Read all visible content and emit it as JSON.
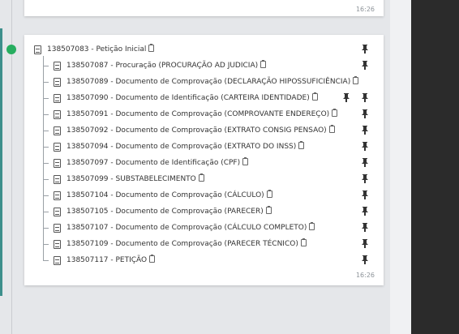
{
  "previous_card": {
    "time": "16:26"
  },
  "main_card": {
    "time": "16:26",
    "root": {
      "label": "138507083 - Petição Inicial"
    },
    "items": [
      {
        "label": "138507087 - Procuração (PROCURAÇÃO AD JUDICIA)",
        "pins": 1
      },
      {
        "label": "138507089 - Documento de Comprovação (DECLARAÇÃO HIPOSSUFICIÊNCIA)",
        "pins": 0
      },
      {
        "label": "138507090 - Documento de Identificação (CARTEIRA IDENTIDADE)",
        "pins": 2
      },
      {
        "label": "138507091 - Documento de Comprovação (COMPROVANTE ENDEREÇO)",
        "pins": 1
      },
      {
        "label": "138507092 - Documento de Comprovação (EXTRATO CONSIG PENSAO)",
        "pins": 1
      },
      {
        "label": "138507094 - Documento de Comprovação (EXTRATO DO INSS)",
        "pins": 1
      },
      {
        "label": "138507097 - Documento de Identificação (CPF)",
        "pins": 1
      },
      {
        "label": "138507099 - SUBSTABELECIMENTO",
        "pins": 1
      },
      {
        "label": "138507104 - Documento de Comprovação (CÁLCULO)",
        "pins": 1
      },
      {
        "label": "138507105 - Documento de Comprovação (PARECER)",
        "pins": 1
      },
      {
        "label": "138507107 - Documento de Comprovação (CÁLCULO COMPLETO)",
        "pins": 1
      },
      {
        "label": "138507109 - Documento de Comprovação (PARECER TÉCNICO)",
        "pins": 1
      },
      {
        "label": "138507117 - PETIÇÃO",
        "pins": 1
      }
    ]
  },
  "icons": {
    "document": "file-icon",
    "copy": "clipboard-icon",
    "pin": "pin-icon",
    "status": "status-dot"
  },
  "colors": {
    "status_dot": "#27ae60",
    "accent_bar": "#3d8f8c",
    "dark_panel": "#2b2b2b"
  }
}
